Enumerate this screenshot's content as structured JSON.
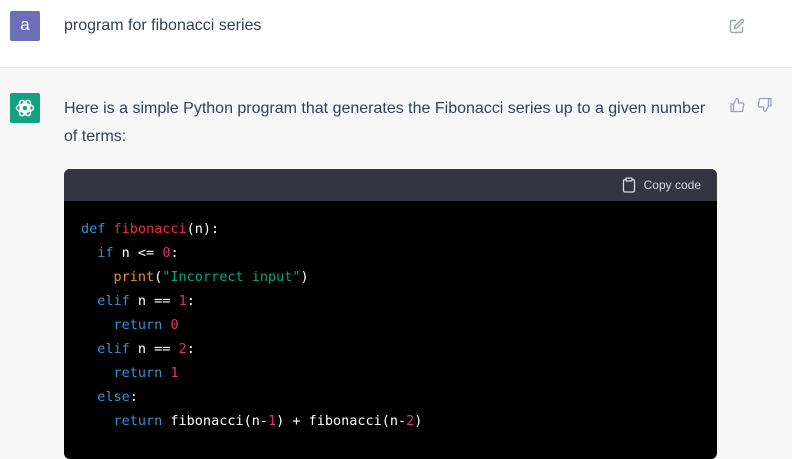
{
  "user": {
    "avatar_letter": "a",
    "prompt": "program for fibonacci series"
  },
  "assistant": {
    "intro": "Here is a simple Python program that generates the Fibonacci series up to a given number of terms:",
    "code_block": {
      "copy_label": "Copy code",
      "lines": [
        [
          "def ",
          " ",
          "fibonacci",
          "(n):"
        ],
        [
          "  ",
          "if",
          " n <= ",
          "0",
          ":"
        ],
        [
          "    ",
          "print",
          "(",
          "\"Incorrect input\"",
          ")"
        ],
        [
          "  ",
          "elif",
          " n == ",
          "1",
          ":"
        ],
        [
          "    ",
          "return",
          " ",
          "0"
        ],
        [
          "  ",
          "elif",
          " n == ",
          "2",
          ":"
        ],
        [
          "    ",
          "return",
          " ",
          "1"
        ],
        [
          "  ",
          "else",
          ":"
        ],
        [
          "    ",
          "return",
          " fibonacci(n-",
          "1",
          ") + fibonacci(n-",
          "2",
          ")"
        ]
      ]
    }
  },
  "icons": {
    "edit": "edit-icon",
    "logo": "openai-logo-icon",
    "thumbs_up": "thumbs-up-icon",
    "thumbs_down": "thumbs-down-icon",
    "clipboard": "clipboard-icon"
  },
  "colors": {
    "user_avatar": "#6c6fb5",
    "assistant_avatar": "#10a37f",
    "code_background": "#000000",
    "code_header": "#343541"
  }
}
